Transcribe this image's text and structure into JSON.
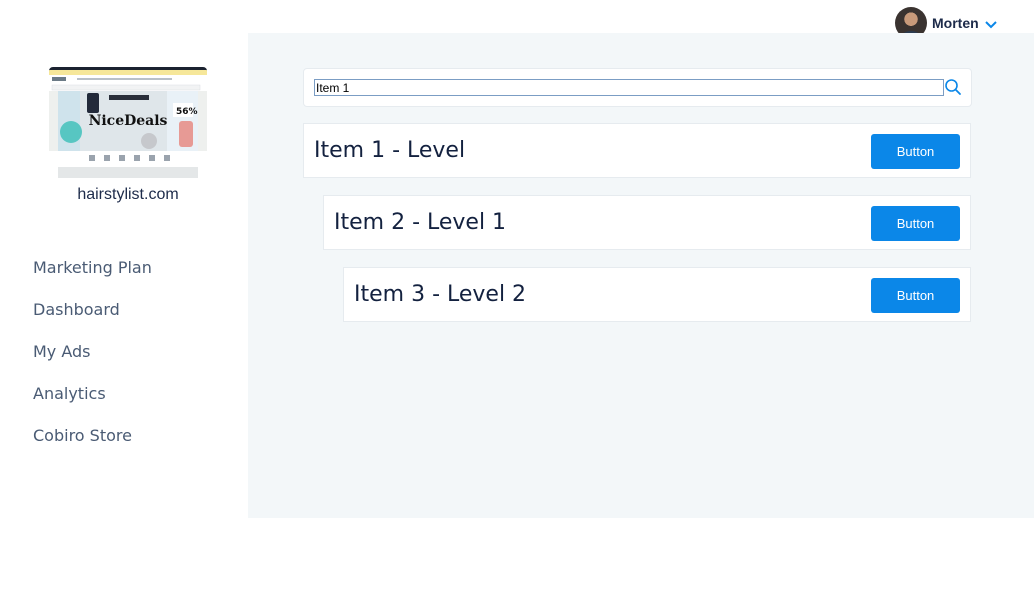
{
  "user": {
    "name": "Morten",
    "avatar_icon": "user-avatar",
    "menu_icon": "chevron-down-icon"
  },
  "sidebar": {
    "brand": {
      "thumbnail_text": "NiceDeals",
      "thumbnail_promo": "56%",
      "site": "hairstylist.com"
    },
    "items": [
      {
        "label": "Marketing Plan"
      },
      {
        "label": "Dashboard"
      },
      {
        "label": "My Ads"
      },
      {
        "label": "Analytics"
      },
      {
        "label": "Cobiro Store"
      }
    ]
  },
  "search": {
    "value": "Item 1",
    "icon": "search-icon"
  },
  "rows": [
    {
      "label": "Item 1 - Level",
      "button": "Button"
    },
    {
      "label": "Item 2 - Level 1",
      "button": "Button"
    },
    {
      "label": "Item 3 - Level 2",
      "button": "Button"
    }
  ],
  "colors": {
    "accent": "#0b87e8",
    "panel_bg": "#f3f7f9",
    "nav_text": "#4a5b74",
    "heading_text": "#13213f"
  }
}
